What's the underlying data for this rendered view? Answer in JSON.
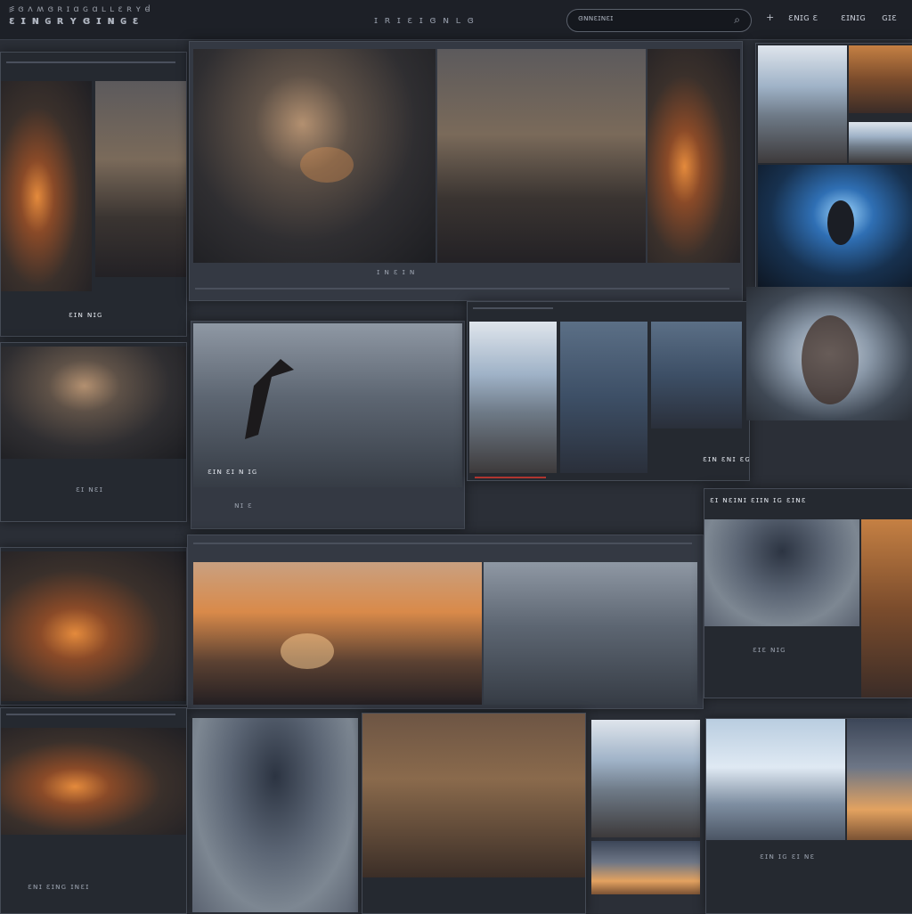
{
  "app": {
    "brand_line1": "꠵ ɞ ᴧ ʍ ɞ ʀ ɪ ɑ ɢ ɑ ʟ ʟ ɛ ʀ ʏ ꟈ",
    "brand_line2": "ɛ ɪ ɴ ɢ ʀ ʏ ɞ ɪ ɴ ɢ ɛ",
    "nav": "ɪ ʀ ɪ ɛ  ɪ ɞ  ɴ ʟ ɞ"
  },
  "search": {
    "placeholder": "ɞɴɴɛɪɴɛɪ",
    "icon": "search-icon"
  },
  "toolbar": {
    "add_label": "+",
    "filter_label": "ɛɴɪɢ ɛ",
    "sort_label": "ɛɪɴɪɢ",
    "more_label": "ɢɪɛ"
  },
  "captions": {
    "left1": "ɛɪɴ ɴɪɢ",
    "hero": "ɪ ɴ ɛ ɪ ɴ",
    "dragon": "ɛɪɴ  ɛɪ ɴ ɪɢ",
    "dragon_sub": "ɴɪ ɛ",
    "strip": "ɛɪɴ ɛɴɪ ɛɢ ɛ ɴɪ",
    "left2": "ɛɪ ɴɛɪ",
    "right_hdr": "ɛɪ ɴɛɪɴɪ  ɛɪɪɴ ɪɢ ɛɪɴɛ",
    "right_sub": "ɛɪɛ ɴɪɢ",
    "bottom_left": "ɛɴɪ ɛɪɴɢ ɪɴɛɪ",
    "bottom_right": "ɛɪɴ ɪɢ ɛɪ ɴɛ"
  },
  "colors": {
    "topbar": "#1d2027",
    "accent": "#b0352f",
    "panel": "#343943"
  }
}
